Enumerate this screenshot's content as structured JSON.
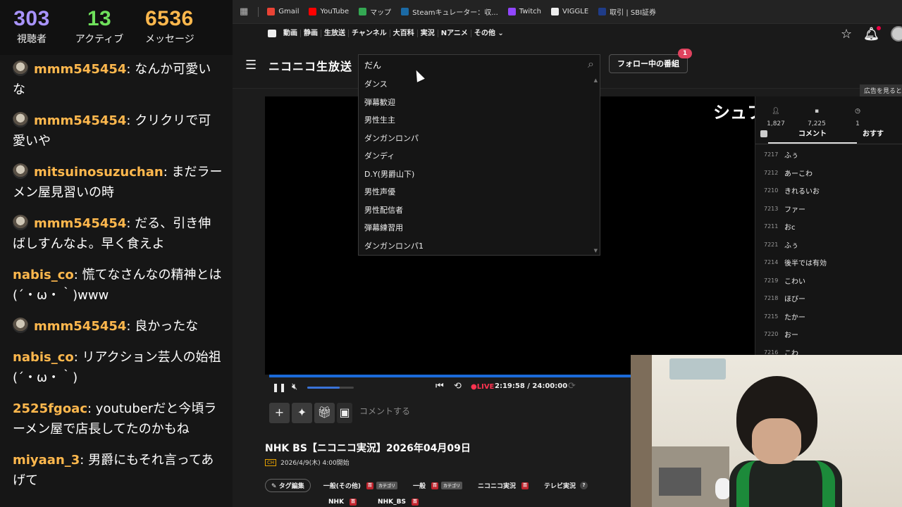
{
  "stream_stats": {
    "viewers": {
      "value": "303",
      "label": "視聴者"
    },
    "active": {
      "value": "13",
      "label": "アクティブ"
    },
    "messages": {
      "value": "6536",
      "label": "メッセージ"
    }
  },
  "stream_chat": [
    {
      "user": "mmm545454",
      "text": ": なんか可愛いな",
      "avatar": true
    },
    {
      "user": "mmm545454",
      "text": ": クリクリで可愛いや",
      "avatar": true
    },
    {
      "user": "mitsuinosuzuchan",
      "text": ": まだラーメン屋見習いの時",
      "avatar": true
    },
    {
      "user": "mmm545454",
      "text": ": だる、引き伸ばしすんなよ。早く食えよ",
      "avatar": true
    },
    {
      "user": "nabis_co",
      "text": ": 慌てなさんなの精神とは(´・ω・｀)www",
      "avatar": false
    },
    {
      "user": "mmm545454",
      "text": ": 良かったな",
      "avatar": true
    },
    {
      "user": "nabis_co",
      "text": ": リアクション芸人の始祖(´・ω・｀)",
      "avatar": false
    },
    {
      "user": "2525fgoac",
      "text": ": youtuberだと今頃ラーメン屋で店長してたのかもね",
      "avatar": false
    },
    {
      "user": "miyaan_3",
      "text": ": 男爵にもそれ言ってあげて",
      "avatar": false
    }
  ],
  "bookmarks": [
    {
      "label": "Gmail",
      "icon": "gmail-icon",
      "color": "#ea4335"
    },
    {
      "label": "YouTube",
      "icon": "youtube-icon",
      "color": "#ff0000"
    },
    {
      "label": "マップ",
      "icon": "maps-icon",
      "color": "#34a853"
    },
    {
      "label": "Steamキュレーター：収...",
      "icon": "steam-icon",
      "color": "#1b6aa5"
    },
    {
      "label": "Twitch",
      "icon": "twitch-icon",
      "color": "#9146ff"
    },
    {
      "label": "VIGGLE",
      "icon": "viggle-icon",
      "color": "#eeeeee"
    },
    {
      "label": "取引 | SBI証券",
      "icon": "sbi-icon",
      "color": "#1f3c88"
    }
  ],
  "nico_nav": {
    "items": [
      "動画",
      "静画",
      "生放送",
      "チャンネル",
      "大百科",
      "実況",
      "Nアニメ",
      "その他 ⌄"
    ]
  },
  "header": {
    "logo": "ニコニコ生放送",
    "search_value": "だん",
    "follow_label": "フォロー中の番組",
    "follow_badge": "1"
  },
  "suggestions": [
    "ダンス",
    "弾幕歓迎",
    "男性生主",
    "ダンガンロンパ",
    "ダンディ",
    "D.Y(男爵山下)",
    "男性声優",
    "男性配信者",
    "弾幕練習用",
    "ダンガンロンパ1"
  ],
  "player": {
    "overlay_title": "シュフ",
    "live_label": "●LIVE",
    "time": "2:19:58 / 24:00:00",
    "volume_level": 0.7,
    "comment_placeholder": "コメントする"
  },
  "side_panel": {
    "ad_note": "広告を見ると",
    "stats": [
      {
        "icon": "viewer-icon",
        "value": "1,827"
      },
      {
        "icon": "comment-icon",
        "value": "7,225"
      },
      {
        "icon": "clock-icon",
        "value": "1"
      }
    ],
    "tab_comments": "コメント",
    "tab_recommend": "おすす",
    "comments": [
      {
        "no": "7217",
        "text": "ふぅ"
      },
      {
        "no": "7212",
        "text": "あーこわ"
      },
      {
        "no": "7210",
        "text": "きれるいお"
      },
      {
        "no": "7213",
        "text": "ファー"
      },
      {
        "no": "7211",
        "text": "おc"
      },
      {
        "no": "7221",
        "text": "ふぅ"
      },
      {
        "no": "7214",
        "text": "後半では有効"
      },
      {
        "no": "7219",
        "text": "こわい"
      },
      {
        "no": "7218",
        "text": "ほびー"
      },
      {
        "no": "7215",
        "text": "たかー"
      },
      {
        "no": "7220",
        "text": "おー"
      },
      {
        "no": "7216",
        "text": "こわ"
      }
    ]
  },
  "program": {
    "title": "NHK BS【ニコニコ実況】2026年04月09日",
    "ch_badge": "CH",
    "date": "2026/4/9(木) 4:00開始",
    "tag_edit": "タグ編集",
    "tags": [
      {
        "label": "一般(その他)",
        "dic": true,
        "cat": "カテゴリ"
      },
      {
        "label": "一般",
        "dic": true,
        "cat": "カテゴリ"
      },
      {
        "label": "ニコニコ実況",
        "dic": true,
        "cat": ""
      },
      {
        "label": "テレビ実況",
        "dic": false,
        "cat": "",
        "help": true
      }
    ],
    "tags2": [
      {
        "label": "NHK"
      },
      {
        "label": "NHK_BS"
      }
    ]
  }
}
